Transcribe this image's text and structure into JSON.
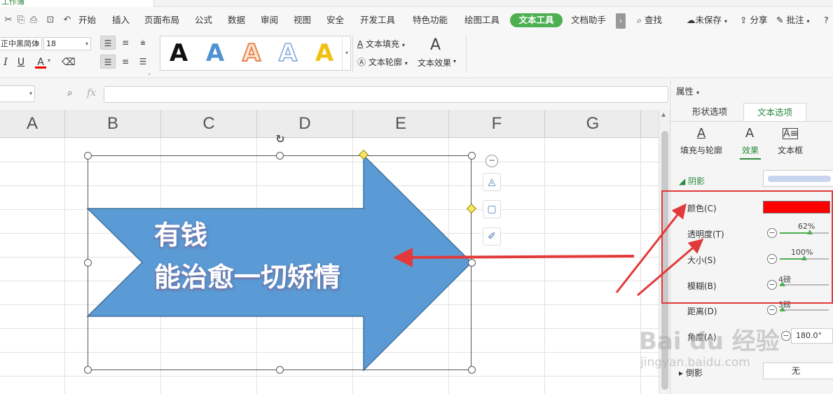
{
  "top_tab": "工作簿",
  "menu": {
    "items": [
      "开始",
      "插入",
      "页面布局",
      "公式",
      "数据",
      "审阅",
      "视图",
      "安全",
      "开发工具",
      "特色功能",
      "绘图工具",
      "文本工具",
      "文档助手"
    ],
    "active": "文本工具",
    "search": "查找",
    "unsaved": "未保存",
    "share": "分享",
    "comment": "批注",
    "help": "?"
  },
  "ribbon": {
    "font_name": "正中黑简体",
    "font_size": "18",
    "format_buttons": [
      "I",
      "U",
      "A",
      "⌫"
    ],
    "style_glyphs": [
      {
        "char": "A",
        "color": "#111111",
        "style": "solid"
      },
      {
        "char": "A",
        "color": "#4f93d2",
        "style": "solid"
      },
      {
        "char": "A",
        "color": "#e8864a",
        "style": "outline-orange"
      },
      {
        "char": "A",
        "color": "#7aa6d8",
        "style": "outline-blue"
      },
      {
        "char": "A",
        "color": "#f2c012",
        "style": "solid"
      }
    ],
    "text_fill": "文本填充",
    "text_outline": "文本轮廓",
    "text_effect": "文本效果"
  },
  "formula": {
    "fx": "fx",
    "value": ""
  },
  "sheet": {
    "columns": [
      "A",
      "B",
      "C",
      "D",
      "E",
      "F",
      "G"
    ]
  },
  "shape": {
    "line1": "有钱",
    "line2": "能治愈一切矫情",
    "fill": "#5b9bd5",
    "stroke": "#41719c"
  },
  "panel": {
    "title": "属性",
    "tabs": [
      "形状选项",
      "文本选项"
    ],
    "active_tab": "文本选项",
    "subtabs": [
      "填充与轮廓",
      "效果",
      "文本框"
    ],
    "active_subtab": "效果",
    "shadow_section": "阴影",
    "rows": {
      "color_label": "颜色(C)",
      "color_value": "#ff0000",
      "transparency_label": "透明度(T)",
      "transparency_value": "62%",
      "transparency_fraction": 0.62,
      "size_label": "大小(S)",
      "size_value": "100%",
      "size_fraction": 0.5,
      "blur_label": "模糊(B)",
      "blur_value": "4磅",
      "blur_fraction": 0.06,
      "distance_label": "距离(D)",
      "distance_value": "3磅",
      "distance_fraction": 0.05,
      "angle_label": "角度(A)",
      "angle_value": "180.0°"
    },
    "reflection_section": "倒影",
    "reflection_value": "无"
  },
  "watermark": {
    "main": "Bai du 经验",
    "sub": "jingyan.baidu.com"
  },
  "colors": {
    "accent_green": "#4caf50",
    "annotation_red": "#e23a3a"
  }
}
